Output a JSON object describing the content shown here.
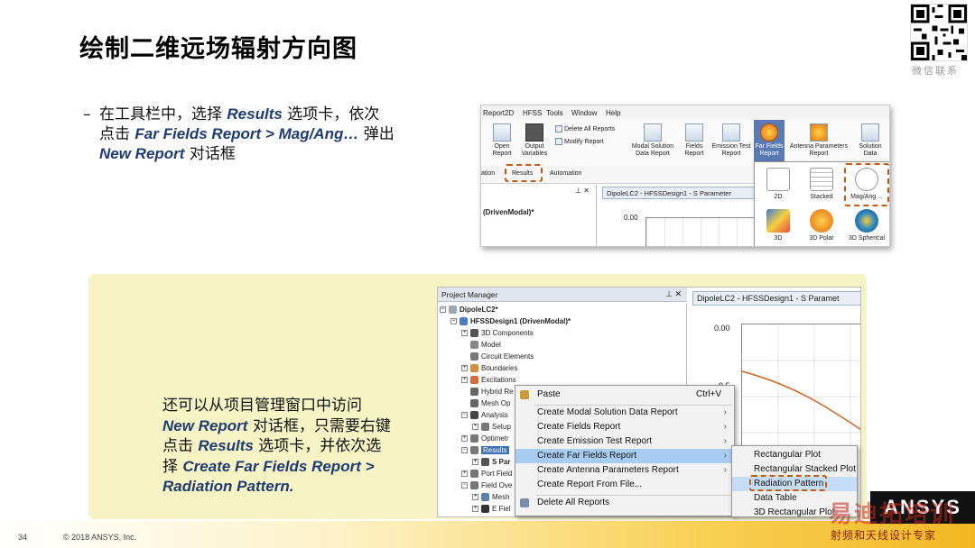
{
  "slide": {
    "title": "绘制二维远场辐射方向图",
    "qr_caption": "微信联系",
    "page_number": "34",
    "copyright": "© 2018 ANSYS, Inc.",
    "logo_text": "ANSYS",
    "watermark_big": "易迪拓培训",
    "watermark_small": "射频和天线设计专家"
  },
  "bullet": {
    "dash": "–",
    "line1_a": "在工具栏中，选择 ",
    "line1_hl": "Results",
    "line1_b": " 选项卡，依次",
    "line2_a": "点击 ",
    "line2_hl": "Far Fields Report > Mag/Ang…",
    "line2_b": " 弹出",
    "line3_hl": "New Report",
    "line3_b": " 对话框"
  },
  "ribbon": {
    "menus": [
      "Report2D",
      "HFSS",
      "Tools",
      "Window",
      "Help"
    ],
    "open_report": "Open\nReport",
    "output_variables": "Output\nVariables",
    "delete_all_reports": "Delete All Reports",
    "modify_report": "Modify Report",
    "modal_solution": "Modal Solution\nData Report",
    "fields": "Fields\nReport",
    "emission": "Emission Test\nReport",
    "far_fields": "Far Fields\nReport",
    "antenna": "Antenna Parameters\nReport",
    "solution_data": "Solution\nData",
    "tabs": [
      "ation",
      "Results",
      "Automation"
    ],
    "pin": "⊥ ✕",
    "driven": "(DrivenModal)*",
    "doc_tab": "DipoleLC2 - HFSSDesign1 - S Parameter",
    "y_label": "0.00",
    "dropdown": [
      "2D",
      "Stacked",
      "Mag/Ang ...",
      "3D",
      "3D Polar",
      "3D Spherical"
    ]
  },
  "panel": {
    "l1": "还可以从项目管理窗口中访问",
    "l2_hl": "New Report",
    "l2_b": " 对话框，只需要右键",
    "l3_a": "点击 ",
    "l3_hl": "Results",
    "l3_b": " 选项卡，并依次选",
    "l4_a": "择 ",
    "l4_hl": "Create Far Fields Report >",
    "l5_hl": "Radiation Pattern."
  },
  "pm": {
    "header": "Project Manager",
    "header_ctl": "⊥ ✕",
    "tree": [
      "DipoleLC2*",
      "HFSSDesign1 (DrivenModal)*",
      "3D Components",
      "Model",
      "Circuit Elements",
      "Boundaries",
      "Excitations",
      "Hybrid Re",
      "Mesh Op",
      "Analysis",
      "Setup",
      "Optimetr",
      "Results",
      "S Par",
      "Port Field",
      "Field Ove",
      "Mesh",
      "E Fiel"
    ],
    "doc_tab": "DipoleLC2 - HFSSDesign1 - S Paramet",
    "y0": "0.00",
    "y1": "-0.5"
  },
  "context_menu": {
    "items": [
      {
        "label": "Paste",
        "shortcut": "Ctrl+V"
      },
      {
        "label": "Create Modal Solution Data Report"
      },
      {
        "label": "Create Fields Report"
      },
      {
        "label": "Create Emission Test Report"
      },
      {
        "label": "Create Far Fields Report"
      },
      {
        "label": "Create Antenna Parameters Report"
      },
      {
        "label": "Create Report From File..."
      },
      {
        "label": "Delete All Reports"
      }
    ],
    "arrow": "›"
  },
  "submenu": {
    "items": [
      "Rectangular Plot",
      "Rectangular Stacked Plot",
      "Radiation Pattern",
      "Data Table",
      "3D Rectangular Plot"
    ]
  },
  "colors": {
    "accent_blue": "#1f3b73",
    "highlight_orange": "#c65a11",
    "panel_yellow": "#f6f4c4"
  }
}
